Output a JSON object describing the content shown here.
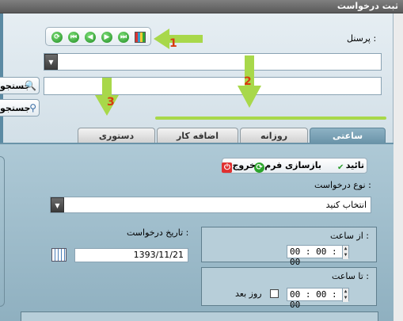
{
  "window": {
    "title": "ثبت درخواست"
  },
  "form": {
    "personnel_label": "پرسنل :",
    "search_buttons": [
      "جستجو",
      "جستجو"
    ]
  },
  "tabs": [
    {
      "label": "ساعتی",
      "active": true
    },
    {
      "label": "روزانه",
      "active": false
    },
    {
      "label": "اضافه کار",
      "active": false
    },
    {
      "label": "دستوری",
      "active": false
    }
  ],
  "toolbar": {
    "confirm_label": "تائید",
    "reset_label": "بازسازی فرم",
    "exit_label": "خروج"
  },
  "request": {
    "type_label": "نوع درخواست :",
    "type_value": "انتخاب کنید",
    "date_label": "تاریخ درخواست :",
    "date_value": "1393/11/21",
    "from_label": "از ساعت :",
    "from_time": "00 : 00 : 00",
    "to_label": "تا ساعت :",
    "to_time": "00 : 00 : 00",
    "next_day_label": "روز بعد"
  },
  "annotations": [
    "1",
    "2",
    "3"
  ],
  "colors": {
    "annotation_arrow": "#a8d84a",
    "annotation_number": "#d83a0f",
    "active_tab": "#6a93a8"
  }
}
